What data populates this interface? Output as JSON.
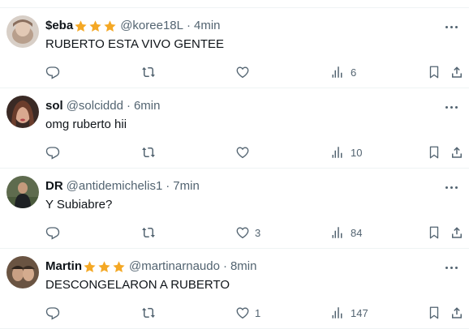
{
  "tweets": [
    {
      "name": "$eba",
      "stars": 3,
      "handle": "@koree18L",
      "separator": "·",
      "time": "4min",
      "text": "RUBERTO ESTA VIVO GENTEE",
      "replies": "",
      "retweets": "",
      "likes": "",
      "views": "6",
      "avatar_color": "#c9b8a8"
    },
    {
      "name": "sol",
      "stars": 0,
      "handle": "@solciddd",
      "separator": "·",
      "time": "6min",
      "text": "omg ruberto hii",
      "replies": "",
      "retweets": "",
      "likes": "",
      "views": "10",
      "avatar_color": "#7a4b3a"
    },
    {
      "name": "DR",
      "stars": 0,
      "handle": "@antidemichelis1",
      "separator": "·",
      "time": "7min",
      "text": "Y Subiabre?",
      "replies": "",
      "retweets": "",
      "likes": "3",
      "views": "84",
      "avatar_color": "#3d4a34"
    },
    {
      "name": "Martin",
      "stars": 3,
      "handle": "@martinarnaudo",
      "separator": "·",
      "time": "8min",
      "text": "DESCONGELARON A RUBERTO",
      "replies": "",
      "retweets": "",
      "likes": "1",
      "views": "147",
      "avatar_color": "#5a4636"
    }
  ],
  "icons": {
    "reply": "reply-icon",
    "retweet": "retweet-icon",
    "like": "heart-icon",
    "views": "views-icon",
    "bookmark": "bookmark-icon",
    "share": "share-icon",
    "more": "more-icon",
    "star": "star-icon"
  },
  "colors": {
    "text": "#0f1419",
    "secondary": "#536471",
    "border": "#eff3f4",
    "star": "#f4a825"
  }
}
